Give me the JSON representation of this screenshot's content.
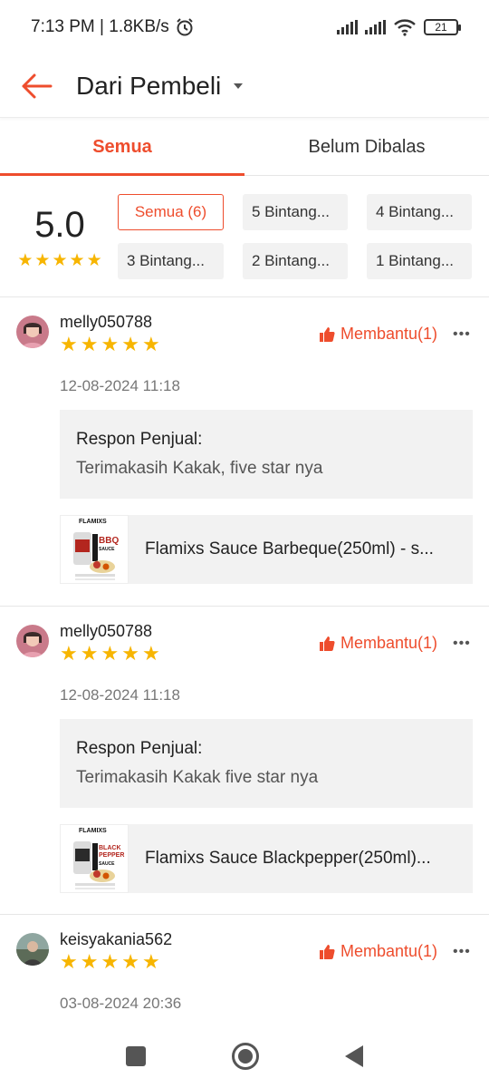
{
  "status_bar": {
    "text": "7:13 PM | 1.8KB/s",
    "battery": "21"
  },
  "header": {
    "title": "Dari Pembeli"
  },
  "tabs": [
    {
      "label": "Semua",
      "active": true
    },
    {
      "label": "Belum Dibalas",
      "active": false
    }
  ],
  "summary": {
    "score": "5.0",
    "stars": [
      "★",
      "★",
      "★",
      "★",
      "★"
    ],
    "filters": [
      "Semua (6)",
      "5 Bintang...",
      "4 Bintang...",
      "3 Bintang...",
      "2 Bintang...",
      "1 Bintang..."
    ]
  },
  "reviews": [
    {
      "username": "melly050788",
      "stars": [
        "★",
        "★",
        "★",
        "★",
        "★"
      ],
      "helpful": "Membantu(1)",
      "more": "•••",
      "date": "12-08-2024 11:18",
      "reply_label": "Respon Penjual:",
      "reply_text": "Terimakasih Kakak, five star nya",
      "product_name": "Flamixs Sauce Barbeque(250ml) - s...",
      "thumb_brand": "FLAMIXS",
      "thumb_flavor": "BBQ",
      "thumb_suffix": "SAUCE"
    },
    {
      "username": "melly050788",
      "stars": [
        "★",
        "★",
        "★",
        "★",
        "★"
      ],
      "helpful": "Membantu(1)",
      "more": "•••",
      "date": "12-08-2024 11:18",
      "reply_label": "Respon Penjual:",
      "reply_text": "Terimakasih Kakak five star nya",
      "product_name": "Flamixs Sauce Blackpepper(250ml)...",
      "thumb_brand": "FLAMIXS",
      "thumb_flavor": "BLACK PEPPER",
      "thumb_suffix": "SAUCE"
    },
    {
      "username": "keisyakania562",
      "stars": [
        "★",
        "★",
        "★",
        "★",
        "★"
      ],
      "helpful": "Membantu(1)",
      "more": "•••",
      "date": "03-08-2024 20:36"
    }
  ],
  "colors": {
    "accent": "#ee4d2d",
    "star": "#f7b500"
  }
}
